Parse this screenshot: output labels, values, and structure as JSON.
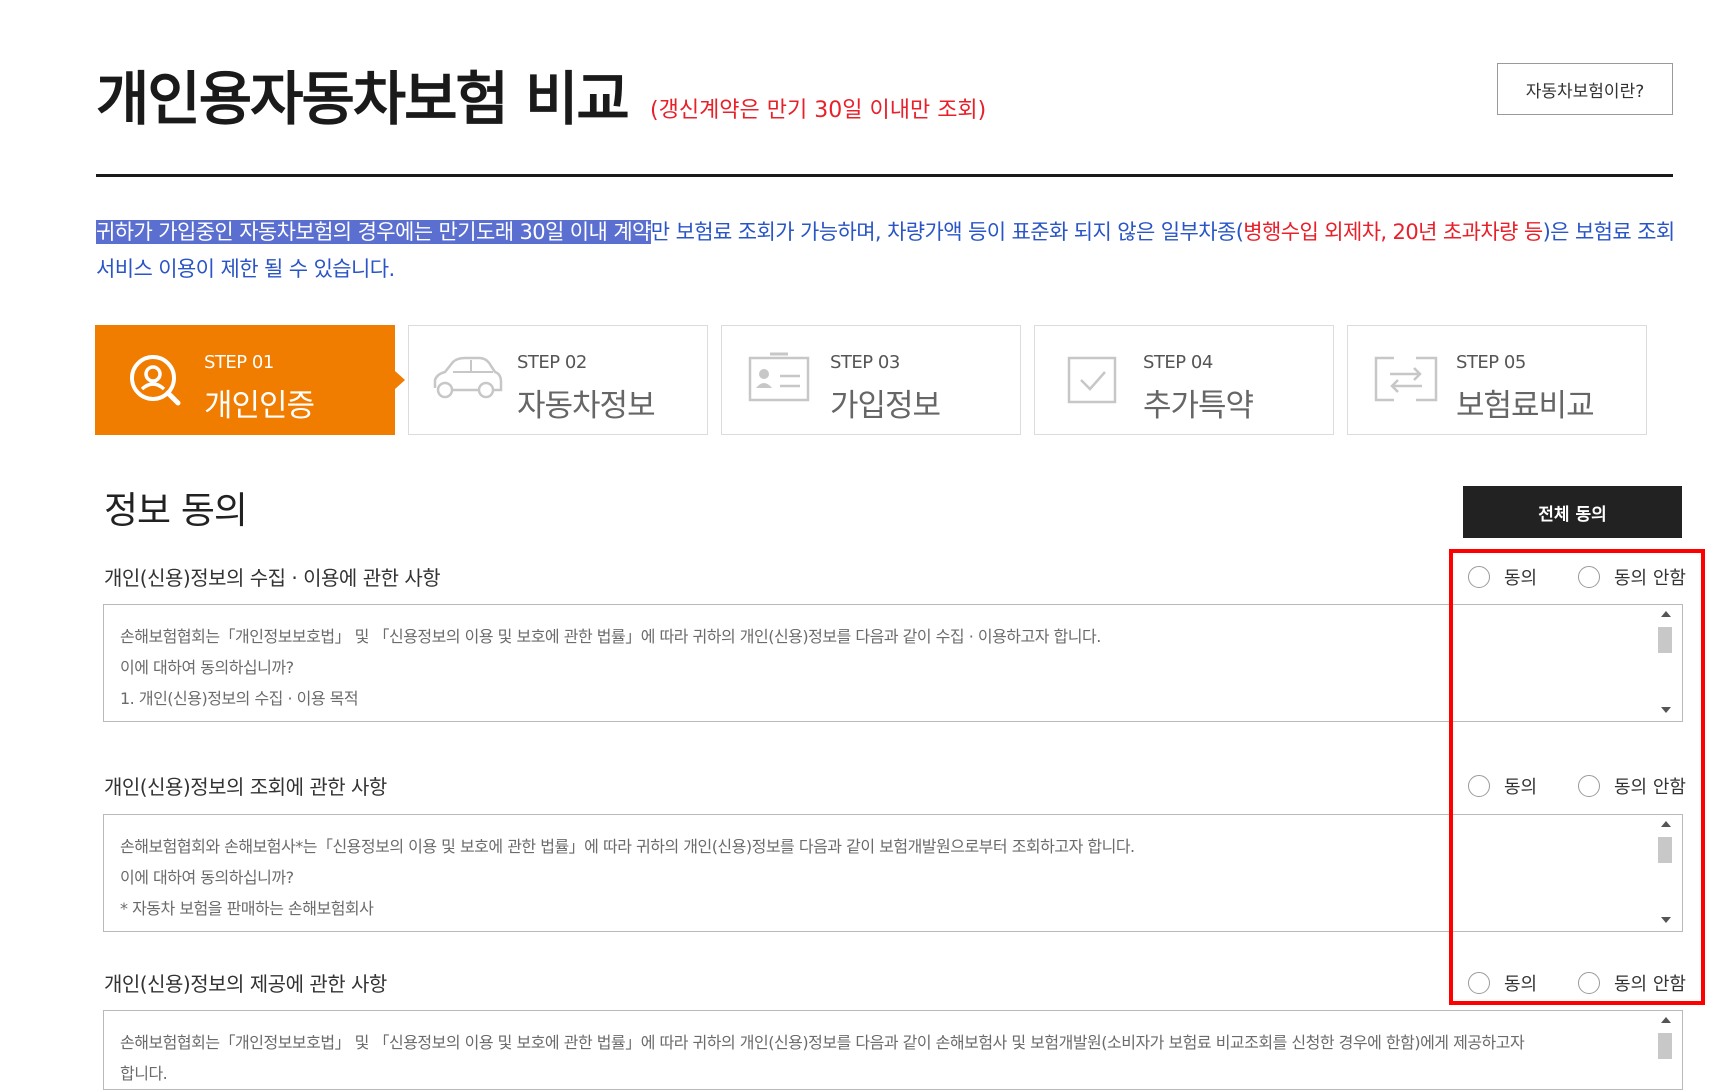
{
  "header": {
    "title": "개인용자동차보험 비교",
    "subtitle": "(갱신계약은 만기 30일 이내만 조회)",
    "help_button": "자동차보험이란?"
  },
  "notice": {
    "highlighted": "귀하가 가입중인 자동차보험의 경우에는 만기도래 30일 이내 계약",
    "part2": "만 보험료 조회가 가능하며, 차량가액 등이 표준화 되지 않은 일부차종(",
    "red1": "병행수입 외제차, 20년 초과차량 등",
    "part3": ")은 보험료 조회서비스 이용이 제한 될 수 있습니다."
  },
  "steps": [
    {
      "num": "STEP 01",
      "name": "개인인증",
      "icon": "user-search-icon",
      "active": true
    },
    {
      "num": "STEP 02",
      "name": "자동차정보",
      "icon": "car-icon",
      "active": false
    },
    {
      "num": "STEP 03",
      "name": "가입정보",
      "icon": "id-card-icon",
      "active": false
    },
    {
      "num": "STEP 04",
      "name": "추가특약",
      "icon": "checkbox-icon",
      "active": false
    },
    {
      "num": "STEP 05",
      "name": "보험료비교",
      "icon": "compare-icon",
      "active": false
    }
  ],
  "consent": {
    "title": "정보 동의",
    "agree_all": "전체 동의",
    "agree_label": "동의",
    "disagree_label": "동의 안함",
    "clauses": [
      {
        "label": "개인(신용)정보의 수집 · 이용에 관한 사항",
        "lines": [
          "손해보험협회는「개인정보보호법」 및 「신용정보의 이용 및 보호에 관한 법률」에 따라 귀하의 개인(신용)정보를 다음과 같이 수집 · 이용하고자 합니다.",
          "이에 대하여 동의하십니까?",
          "1. 개인(신용)정보의 수집 · 이용 목적"
        ]
      },
      {
        "label": "개인(신용)정보의 조회에 관한 사항",
        "lines": [
          "손해보험협회와 손해보험사*는「신용정보의 이용 및 보호에 관한 법률」에 따라 귀하의 개인(신용)정보를 다음과 같이 보험개발원으로부터 조회하고자 합니다.",
          "이에 대하여 동의하십니까?",
          "* 자동차 보험을 판매하는 손해보험회사"
        ]
      },
      {
        "label": "개인(신용)정보의 제공에 관한 사항",
        "lines": [
          "손해보험협회는「개인정보보호법」 및 「신용정보의 이용 및 보호에 관한 법률」에 따라 귀하의 개인(신용)정보를 다음과 같이 손해보험사 및 보험개발원(소비자가 보험료 비교조회를 신청한 경우에 한함)에게 제공하고자",
          "합니다."
        ]
      }
    ]
  },
  "colors": {
    "accent_orange": "#f07c00",
    "notice_blue": "#2a55c6",
    "notice_red": "#e8202a",
    "annotation_red": "#ff0000"
  }
}
